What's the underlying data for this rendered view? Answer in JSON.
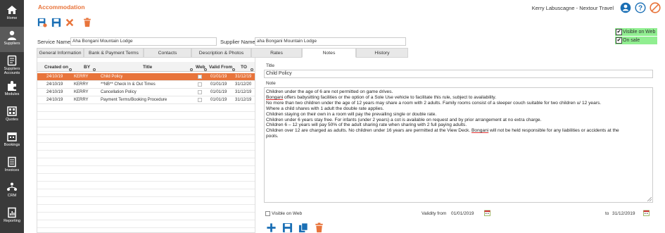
{
  "sidebar": {
    "items": [
      {
        "label": "Home",
        "icon": "home-icon"
      },
      {
        "label": "Suppliers",
        "icon": "suppliers-icon"
      },
      {
        "label": "Suppliers\nAccounts",
        "icon": "supplier-accounts-icon"
      },
      {
        "label": "Modules",
        "icon": "modules-icon"
      },
      {
        "label": "Quotes",
        "icon": "quotes-icon"
      },
      {
        "label": "Bookings",
        "icon": "bookings-icon"
      },
      {
        "label": "Invoices",
        "icon": "invoices-icon"
      },
      {
        "label": "CRM",
        "icon": "crm-icon"
      },
      {
        "label": "Reporting",
        "icon": "reporting-icon"
      }
    ]
  },
  "header": {
    "title": "Accommodation",
    "user": "Kerry Labuscagne - Nextour Travel"
  },
  "flags": {
    "visible_on_web": "Visible on Web",
    "on_sale": "On sale"
  },
  "form": {
    "service_label": "Service Name",
    "service_value": "Aha Bongani Mountain Lodge",
    "supplier_label": "Supplier Name",
    "supplier_value": "aha Bongani Mountain Lodge"
  },
  "tabs": [
    "General Information",
    "Bank & Payment Terms",
    "Contacts",
    "Description & Photos",
    "Rates",
    "Notes",
    "History"
  ],
  "grid": {
    "columns": {
      "created_on": "Created on",
      "by": "BY",
      "title": "Title",
      "web": "Web",
      "valid_from": "Valid From",
      "to": "TO"
    },
    "rows": [
      {
        "created_on": "24/10/19",
        "by": "KERRY",
        "title": "Child Policy",
        "valid_from": "01/01/19",
        "to": "31/12/19"
      },
      {
        "created_on": "24/10/19",
        "by": "KERRY",
        "title": "**NB** Check In & Out Times",
        "valid_from": "01/01/19",
        "to": "31/12/20"
      },
      {
        "created_on": "24/10/19",
        "by": "KERRY",
        "title": "Cancellation Policy",
        "valid_from": "01/01/19",
        "to": "31/12/19"
      },
      {
        "created_on": "24/10/19",
        "by": "KERRY",
        "title": "Payment Terms/Booking Procedure",
        "valid_from": "01/01/19",
        "to": "31/12/19"
      }
    ]
  },
  "detail": {
    "title_label": "Title",
    "title_value": "Child Policy",
    "note_label": "Note",
    "note_lines": [
      "Children under the age of 6 are not permitted on game drives.",
      "Bongani offers babysitting facilities or the option of a Sole Use vehicle to facilitate this rule, subject to availability.",
      "No more than two children under the age of 12 years may share a room with 2 adults.  Family rooms consist of a sleeper couch suitable for two children u/ 12 years.",
      "Where a child shares with 1 adult the double rate applies.",
      "Children staying on their own in a room will pay the prevailing single or double rate.",
      "Children under 6 years stay free. For infants (under 2 years) a cot is available on request and by prior arrangement at no extra charge.",
      "Children 6 – 12 years will pay 50% of the adult sharing rate when sharing with 2 full paying adults.",
      "Children over 12 are charged as adults.  No children under 16 years are permitted at the View Deck.  Bongani will not be held responsible for any liabilities or accidents at the",
      "pools."
    ],
    "visible_on_web": "Visible on Web",
    "validity_from_label": "Validity from",
    "validity_from": "01/01/2019",
    "to_label": "to",
    "to_value": "31/12/2019"
  },
  "colors": {
    "accent": "#e8743b",
    "sidebar": "#3a3a3a",
    "header_icons": "#1a6fb5",
    "delete": "#e8743b",
    "onsale_bg": "#90ee90"
  }
}
